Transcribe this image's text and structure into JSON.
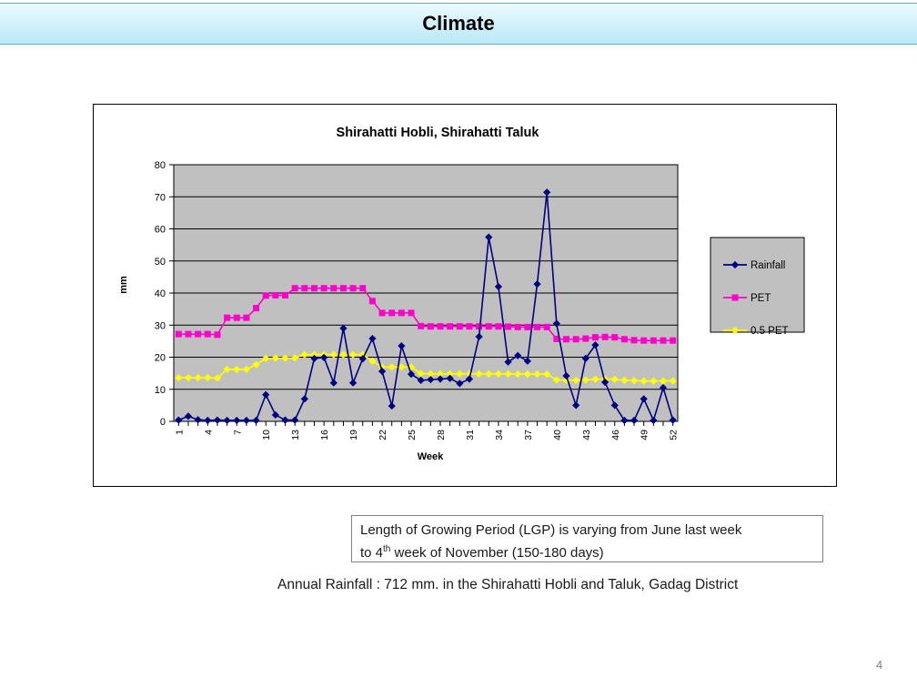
{
  "header": {
    "title": "Climate"
  },
  "chart_data": {
    "type": "line",
    "title": "Shirahatti Hobli, Shirahatti Taluk",
    "xlabel": "Week",
    "ylabel": "mm",
    "ylim": [
      0,
      80
    ],
    "yticks": [
      0,
      10,
      20,
      30,
      40,
      50,
      60,
      70,
      80
    ],
    "xlim": [
      1,
      52
    ],
    "xticks": [
      1,
      4,
      7,
      10,
      13,
      16,
      19,
      22,
      25,
      28,
      31,
      34,
      37,
      40,
      43,
      46,
      49,
      52
    ],
    "grid": "horizontal",
    "legend_position": "right",
    "plot_background": "#c0c0c0",
    "x": [
      1,
      2,
      3,
      4,
      5,
      6,
      7,
      8,
      9,
      10,
      11,
      12,
      13,
      14,
      15,
      16,
      17,
      18,
      19,
      20,
      21,
      22,
      23,
      24,
      25,
      26,
      27,
      28,
      29,
      30,
      31,
      32,
      33,
      34,
      35,
      36,
      37,
      38,
      39,
      40,
      41,
      42,
      43,
      44,
      45,
      46,
      47,
      48,
      49,
      50,
      51,
      52
    ],
    "series": [
      {
        "name": "Rainfall",
        "color": "#000080",
        "marker": "diamond",
        "values": [
          0.4,
          1.6,
          0.5,
          0.3,
          0.4,
          0.3,
          0.3,
          0.3,
          0.3,
          8.3,
          2.0,
          0.4,
          0.4,
          7.0,
          19.6,
          19.9,
          12.0,
          29.0,
          12.0,
          19.5,
          25.8,
          15.6,
          4.8,
          23.5,
          14.7,
          12.8,
          13.0,
          13.2,
          13.4,
          11.8,
          13.2,
          26.4,
          57.4,
          42.0,
          18.5,
          20.5,
          18.8,
          42.8,
          71.4,
          30.5,
          14.2,
          5.0,
          19.6,
          23.8,
          12.2,
          5.0,
          0.3,
          0.3,
          7.0,
          0.3,
          10.5,
          0.4
        ]
      },
      {
        "name": "PET",
        "color": "#ff00cc",
        "marker": "square",
        "values": [
          27.2,
          27.2,
          27.2,
          27.2,
          27.0,
          32.3,
          32.3,
          32.3,
          35.3,
          39.2,
          39.3,
          39.3,
          41.5,
          41.5,
          41.5,
          41.5,
          41.5,
          41.5,
          41.5,
          41.5,
          37.5,
          33.8,
          33.8,
          33.8,
          33.8,
          29.7,
          29.6,
          29.6,
          29.6,
          29.6,
          29.6,
          29.6,
          29.6,
          29.6,
          29.5,
          29.4,
          29.4,
          29.4,
          29.4,
          25.7,
          25.6,
          25.6,
          25.8,
          26.2,
          26.3,
          26.2,
          25.6,
          25.3,
          25.2,
          25.2,
          25.2,
          25.2
        ]
      },
      {
        "name": "0.5 PET",
        "color": "#ffff00",
        "marker": "diamond",
        "values": [
          13.6,
          13.6,
          13.6,
          13.6,
          13.5,
          16.2,
          16.2,
          16.2,
          17.7,
          19.6,
          19.7,
          19.7,
          19.8,
          20.8,
          20.8,
          20.8,
          20.8,
          20.8,
          20.8,
          20.8,
          18.8,
          16.9,
          16.9,
          16.9,
          16.9,
          14.9,
          14.8,
          14.8,
          14.8,
          14.8,
          14.8,
          14.8,
          14.8,
          14.8,
          14.8,
          14.7,
          14.7,
          14.7,
          14.7,
          12.9,
          12.8,
          12.8,
          12.9,
          13.1,
          13.2,
          13.1,
          12.8,
          12.7,
          12.6,
          12.6,
          12.6,
          12.6
        ]
      }
    ]
  },
  "callout": {
    "line1_before": "Length of Growing Period (LGP) is varying from June last week",
    "line2_a": "to 4",
    "line2_sup": "th",
    "line2_b": " week of November (150-180 days)"
  },
  "annual_rainfall": "Annual Rainfall : 712 mm. in the Shirahatti Hobli and Taluk, Gadag District",
  "page_number": "4"
}
